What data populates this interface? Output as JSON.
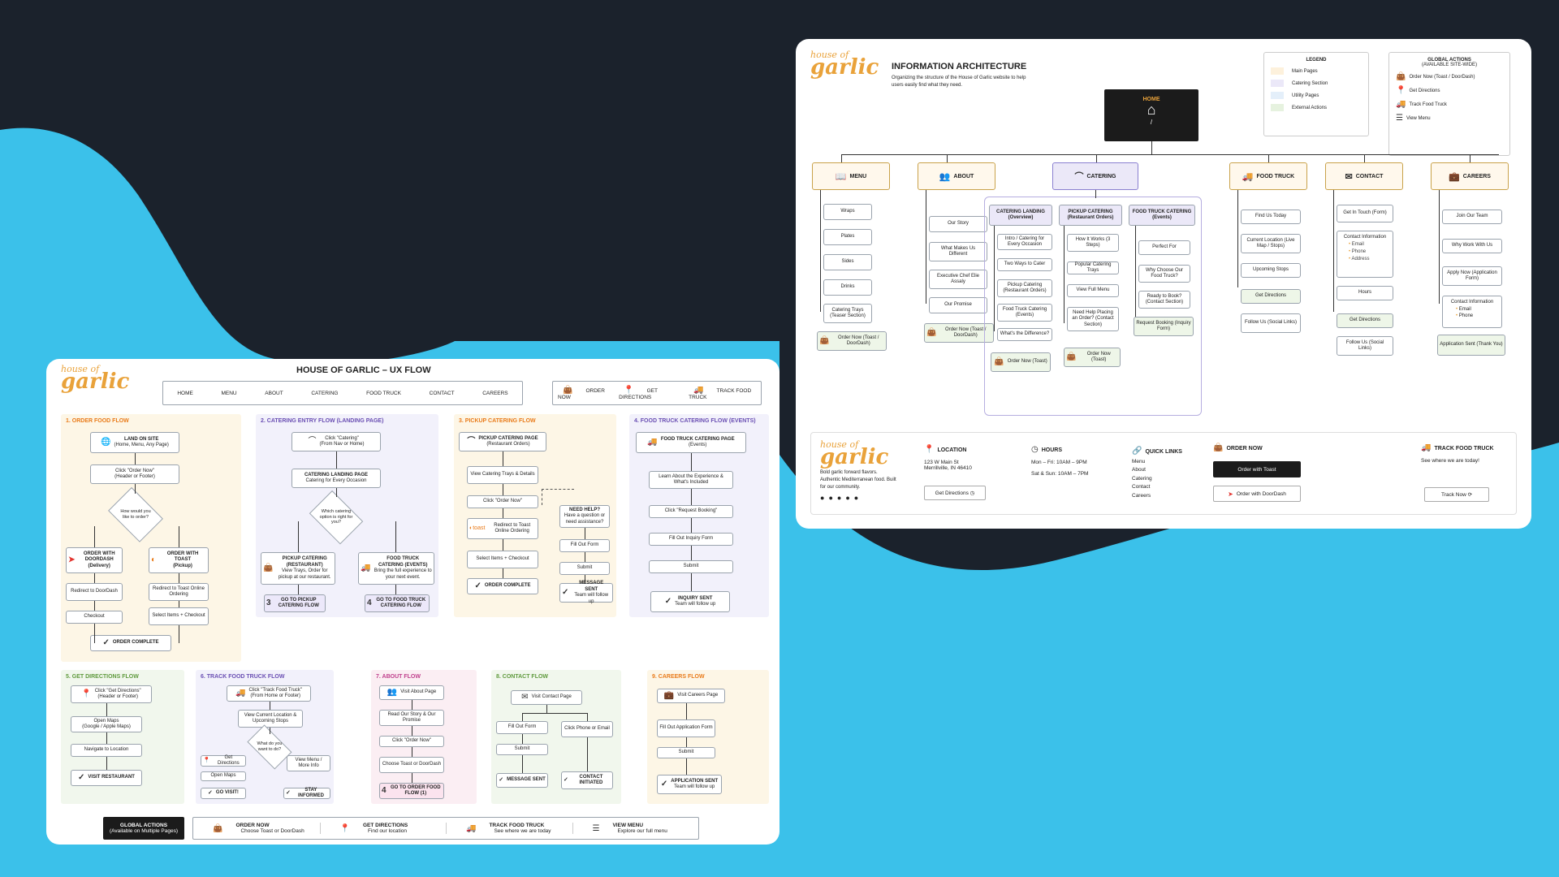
{
  "colors": {
    "background": "#1b222c",
    "wave": "#3bc1ea",
    "brand": "#e9a23a",
    "orderSec": "#fdf6e6",
    "cateringSec": "#f2f1fb",
    "pickupSec": "#fdf6e6",
    "truckSec": "#f2f1fb",
    "directionsSec": "#f1f7ed",
    "aboutSec": "#fbeef3",
    "contactSec": "#f1f7ed",
    "careersSec": "#fdf6e6",
    "orange": "#e97b1a",
    "purple": "#6a4fb3",
    "green": "#5f9a3d",
    "pink": "#c0408d"
  },
  "logo": {
    "line1": "house of",
    "line2": "garlic"
  },
  "ux": {
    "title": "HOUSE OF GARLIC – UX FLOW",
    "nav": [
      "HOME",
      "MENU",
      "ABOUT",
      "CATERING",
      "FOOD TRUCK",
      "CONTACT",
      "CAREERS"
    ],
    "actions": [
      "ORDER NOW",
      "GET DIRECTIONS",
      "TRACK FOOD TRUCK"
    ],
    "s1": {
      "title": "1. ORDER FOOD FLOW",
      "land": "LAND ON SITE",
      "land_sub": "(Home, Menu, Any Page)",
      "click": "Click \"Order Now\"",
      "click_sub": "(Header or Footer)",
      "q": "How would you like to order?",
      "dd": "ORDER WITH DOORDASH",
      "dd_sub": "(Delivery)",
      "toast": "ORDER WITH TOAST",
      "toast_sub": "(Pickup)",
      "r1": "Redirect to DoorDash",
      "r2": "Redirect to Toast Online Ordering",
      "co": "Checkout",
      "si": "Select Items + Checkout",
      "done": "ORDER COMPLETE"
    },
    "s2": {
      "title": "2. CATERING ENTRY FLOW (LANDING PAGE)",
      "click": "Click \"Catering\"",
      "click_sub": "(From Nav or Home)",
      "landing": "CATERING LANDING PAGE",
      "landing_sub": "Catering for Every Occasion",
      "q": "Which catering option is right for you?",
      "pick": "PICKUP CATERING (RESTAURANT)",
      "pick_sub": "View Trays, Order for pickup at our restaurant.",
      "truck": "FOOD TRUCK CATERING (EVENTS)",
      "truck_sub": "Bring the full experience to your next event.",
      "go1": "GO TO PICKUP CATERING FLOW",
      "go2": "GO TO FOOD TRUCK CATERING FLOW",
      "n1": "3",
      "n2": "4"
    },
    "s3": {
      "title": "3. PICKUP CATERING FLOW",
      "page": "PICKUP CATERING PAGE",
      "page_sub": "(Restaurant Orders)",
      "trays": "View Catering Trays & Details",
      "click": "Click \"Order Now\"",
      "redirect": "Redirect to Toast Online Ordering",
      "select": "Select Items + Checkout",
      "done": "ORDER COMPLETE",
      "help": "NEED HELP?",
      "help_sub": "Have a question or need assistance?",
      "fill": "Fill Out Form",
      "submit": "Submit",
      "sent": "MESSAGE SENT",
      "sent_sub": "Team will follow up"
    },
    "s4": {
      "title": "4. FOOD TRUCK CATERING FLOW (EVENTS)",
      "page": "FOOD TRUCK CATERING PAGE",
      "page_sub": "(Events)",
      "learn": "Learn About the Experience & What's Included",
      "req": "Click \"Request Booking\"",
      "fill": "Fill Out Inquiry Form",
      "submit": "Submit",
      "sent": "INQUIRY SENT",
      "sent_sub": "Team will follow up"
    },
    "s5": {
      "title": "5. GET DIRECTIONS FLOW",
      "click": "Click \"Get Directions\"",
      "click_sub": "(Header or Footer)",
      "maps": "Open Maps",
      "maps_sub": "(Google / Apple Maps)",
      "nav": "Navigate to Location",
      "visit": "VISIT RESTAURANT"
    },
    "s6": {
      "title": "6. TRACK FOOD TRUCK FLOW",
      "click": "Click \"Track Food Truck\"",
      "click_sub": "(From Home or Footer)",
      "view": "View Current Location & Upcoming Stops",
      "q": "What do you want to do?",
      "dir": "Get Directions",
      "maps": "Open Maps",
      "menu": "View Menu / More Info",
      "visit": "GO VISIT!",
      "inf": "STAY INFORMED"
    },
    "s7": {
      "title": "7. ABOUT FLOW",
      "visit": "Visit About Page",
      "read": "Read Our Story & Our Promise",
      "click": "Click \"Order Now\"",
      "choose": "Choose Toast or DoorDash",
      "go": "GO TO ORDER FOOD FLOW (1)",
      "n": "4"
    },
    "s8": {
      "title": "8. CONTACT FLOW",
      "visit": "Visit Contact Page",
      "fill": "Fill Out Form",
      "call": "Click Phone or Email",
      "submit": "Submit",
      "sent": "MESSAGE SENT",
      "init": "CONTACT INITIATED"
    },
    "s9": {
      "title": "9. CAREERS FLOW",
      "visit": "Visit Careers Page",
      "fill": "Fill Out Application Form",
      "submit": "Submit",
      "sent": "APPLICATION SENT",
      "sent_sub": "Team will follow up"
    },
    "global": {
      "label": "GLOBAL ACTIONS",
      "sub": "(Available on Multiple Pages)",
      "items": [
        {
          "t": "ORDER NOW",
          "s": "Choose Toast or DoorDash"
        },
        {
          "t": "GET DIRECTIONS",
          "s": "Find our location"
        },
        {
          "t": "TRACK FOOD TRUCK",
          "s": "See where we are today"
        },
        {
          "t": "VIEW MENU",
          "s": "Explore our full menu"
        }
      ]
    }
  },
  "ia": {
    "title": "INFORMATION ARCHITECTURE",
    "desc": "Organizing the structure of the House of Garlic website to help users easily find what they need.",
    "home": "HOME",
    "home_path": "/",
    "legend": {
      "title": "LEGEND",
      "items": [
        {
          "label": "Main Pages",
          "color": "#fdf1dc"
        },
        {
          "label": "Catering Section",
          "color": "#ebe8f8"
        },
        {
          "label": "Utility Pages",
          "color": "#e4effa"
        },
        {
          "label": "External Actions",
          "color": "#e6f2df"
        }
      ]
    },
    "global": {
      "title": "GLOBAL ACTIONS",
      "sub": "(AVAILABLE SITE-WIDE)",
      "items": [
        "Order Now (Toast / DoorDash)",
        "Get Directions",
        "Track Food Truck",
        "View Menu"
      ]
    },
    "menu": {
      "label": "MENU",
      "items": [
        "Wraps",
        "Plates",
        "Sides",
        "Drinks",
        "Catering Trays (Teaser Section)"
      ],
      "order": "Order Now (Toast / DoorDash)"
    },
    "about": {
      "label": "ABOUT",
      "items": [
        "Our Story",
        "What Makes Us Different",
        "Executive Chef Elie Assaly",
        "Our Promise"
      ],
      "order": "Order Now (Toast / DoorDash)"
    },
    "catering": {
      "label": "CATERING",
      "landing": "CATERING LANDING (Overview)",
      "landing_items": [
        "Intro / Catering for Every Occasion",
        "Two Ways to Cater",
        "Pickup Catering (Restaurant Orders)",
        "Food Truck Catering (Events)",
        "What's the Difference?"
      ],
      "pickup": "PICKUP CATERING (Restaurant Orders)",
      "pickup_items": [
        "How It Works (3 Steps)",
        "Popular Catering Trays",
        "View Full Menu",
        "Need Help Placing an Order? (Contact Section)"
      ],
      "truck": "FOOD TRUCK CATERING (Events)",
      "truck_items": [
        "Perfect For",
        "Why Choose Our Food Truck?",
        "Ready to Book? (Contact Section)",
        "Request Booking (Inquiry Form)"
      ],
      "order1": "Order Now (Toast)",
      "order2": "Order Now (Toast)"
    },
    "truck": {
      "label": "FOOD TRUCK",
      "items": [
        "Find Us Today",
        "Current Location (Live Map / Stops)",
        "Upcoming Stops",
        "Get Directions",
        "Follow Us (Social Links)"
      ]
    },
    "contact": {
      "label": "CONTACT",
      "items": [
        "Get In Touch (Form)",
        "Contact Information",
        "Hours",
        "Get Directions",
        "Follow Us (Social Links)"
      ],
      "sub": [
        "Email",
        "Phone",
        "Address"
      ]
    },
    "careers": {
      "label": "CAREERS",
      "items": [
        "Join Our Team",
        "Why Work With Us",
        "Apply Now (Application Form)",
        "Contact Information",
        "Application Sent (Thank You)"
      ],
      "sub": [
        "Email",
        "Phone"
      ]
    },
    "footer": {
      "tagline": "Bold garlic forward flavors. Authentic Mediterranean food. Built for our community.",
      "location": "LOCATION",
      "addr1": "123 W Main St",
      "addr2": "Merrillville, IN 46410",
      "dir": "Get Directions",
      "hours": "HOURS",
      "h1": "Mon – Fri: 10AM – 9PM",
      "h2": "Sat & Sun: 10AM – 7PM",
      "quick": "QUICK LINKS",
      "links": [
        "Menu",
        "About",
        "Catering",
        "Contact",
        "Careers"
      ],
      "order": "ORDER NOW",
      "toast": "Order with Toast",
      "dd": "Order with DoorDash",
      "track": "TRACK FOOD TRUCK",
      "track_sub": "See where we are today!",
      "track_btn": "Track Now"
    }
  }
}
